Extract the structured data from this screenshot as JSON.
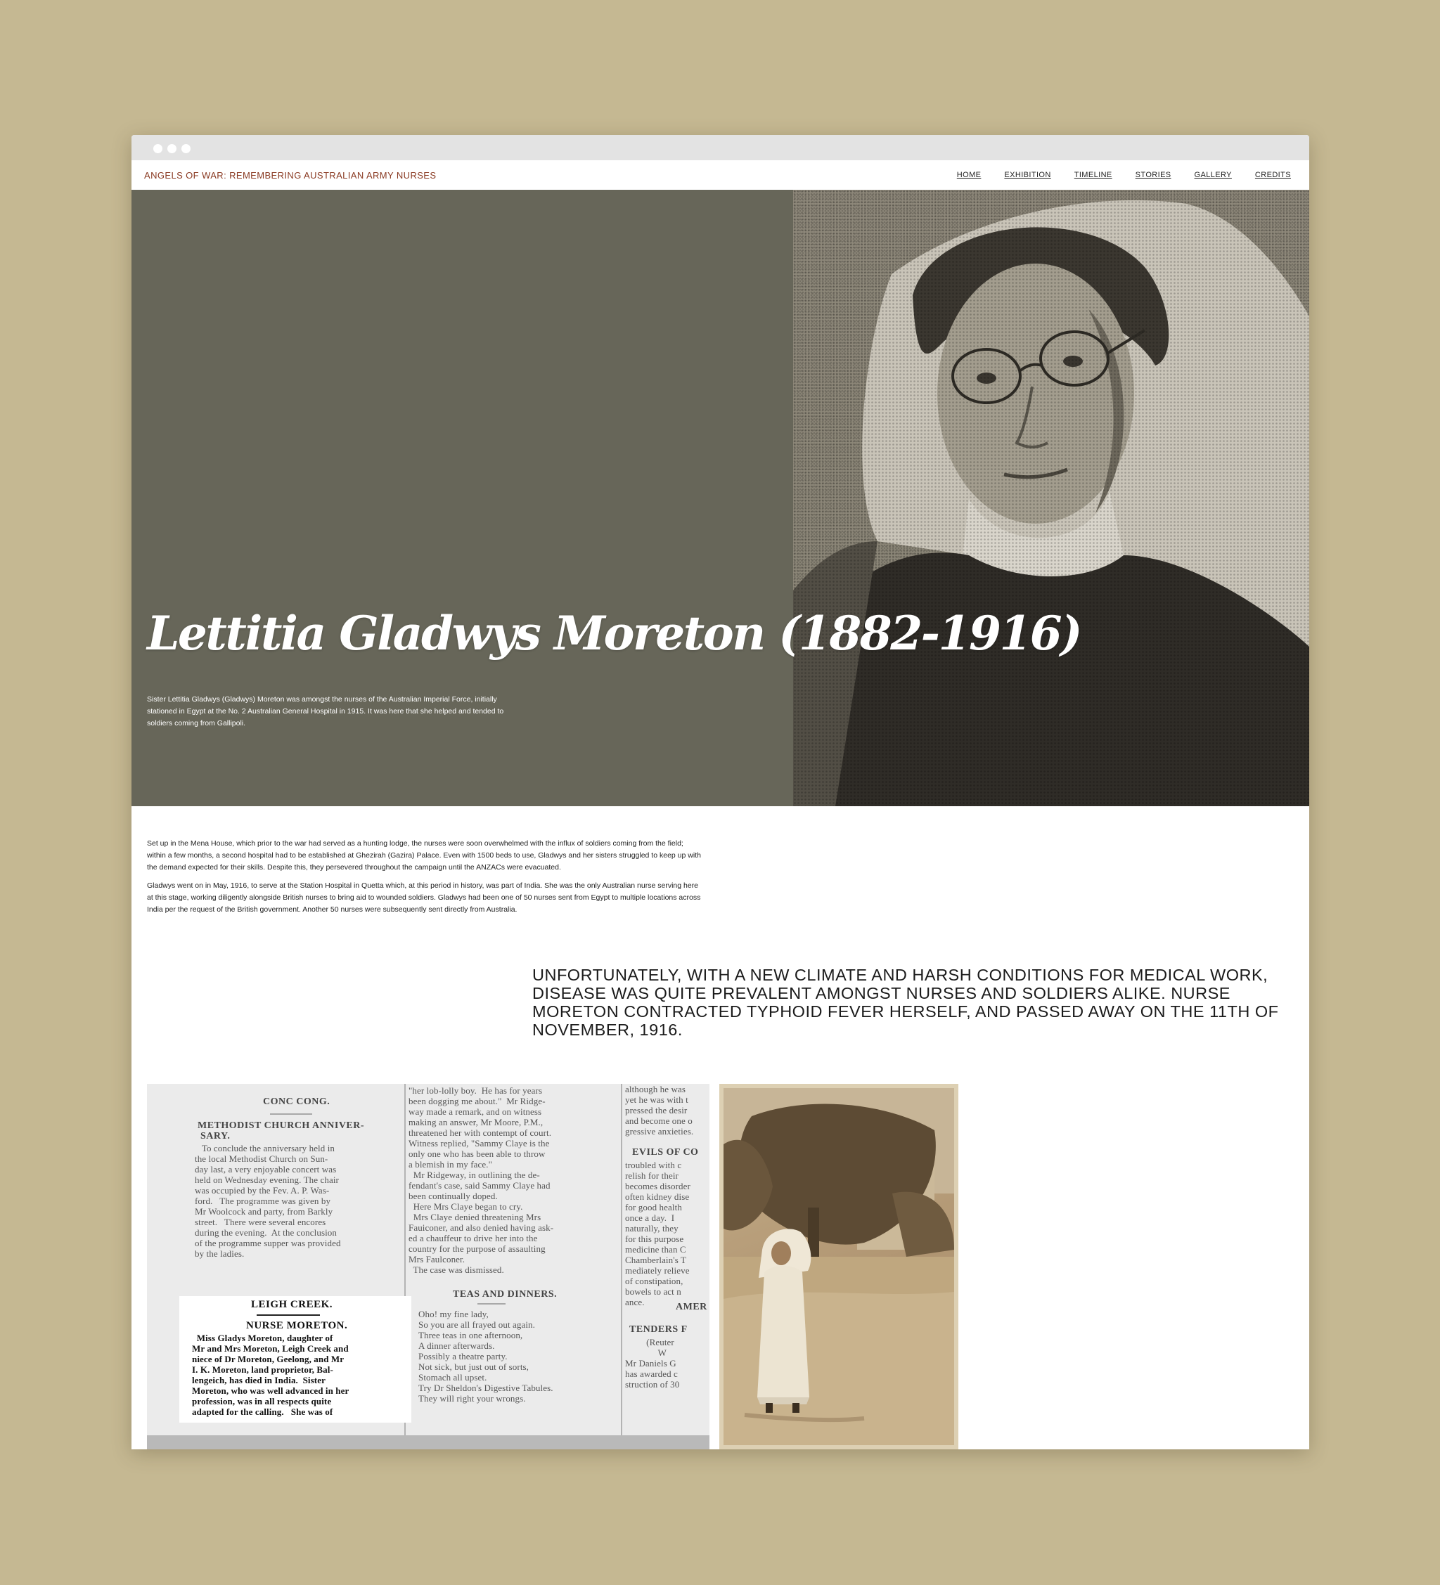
{
  "nav": {
    "site_title": "ANGELS OF WAR: REMEMBERING AUSTRALIAN ARMY NURSES",
    "items": [
      "HOME",
      "EXHIBITION",
      "TIMELINE",
      "STORIES",
      "GALLERY",
      "CREDITS"
    ]
  },
  "hero": {
    "title": "Lettitia Gladwys Moreton (1882-1916)",
    "intro": "Sister Lettitia Gladwys (Gladwys) Moreton was amongst the nurses of the Australian Imperial Force, initially stationed in Egypt at the No. 2 Australian General Hospital in 1915. It was here that she helped and tended to soldiers coming from Gallipoli."
  },
  "body": {
    "p1": "Set up in the Mena House, which prior to the war had served as a hunting lodge, the nurses were soon overwhelmed with the influx of soldiers coming from the field; within a few months, a second hospital had to be established at Ghezirah (Gazira) Palace. Even with 1500 beds to use, Gladwys and her sisters struggled to keep up with the demand expected for their skills. Despite this, they persevered throughout the campaign until the ANZACs were evacuated.",
    "p2": "Gladwys went on in May, 1916, to serve at the Station Hospital in Quetta which, at this period in history, was part of India. She was the only Australian nurse serving here at this stage, working diligently alongside British nurses to bring aid to wounded soldiers. Gladwys had been one of 50 nurses sent from Egypt to multiple locations across India per the request of the British government. Another 50 nurses were subsequently sent directly from Australia."
  },
  "pullquote": "Unfortunately, with a new climate and harsh conditions for medical work, disease was quite prevalent amongst nurses and soldiers alike. Nurse Moreton contracted typhoid fever herself, and passed away on the 11th of November, 1916.",
  "clipping": {
    "col1_head1": "CONC CONG.",
    "col1_head2": "METHODIST CHURCH ANNIVER-\n SARY.",
    "col1_text": "   To conclude the anniversary held in\nthe local Methodist Church on Sun-\nday last, a very enjoyable concert was\nheld on Wednesday evening. The chair\nwas occupied by the Fev. A. P. Was-\nford.   The programme was given by\nMr Woolcock and party, from Barkly\nstreet.   There were several encores\nduring the evening.  At the conclusion\nof the programme supper was provided\nby the ladies.",
    "notice_head1": "LEIGH CREEK.",
    "notice_head2": "NURSE MORETON.",
    "notice_text": "  Miss Gladys Moreton, daughter of\nMr and Mrs Moreton, Leigh Creek and\nniece of Dr Moreton, Geelong, and Mr\nI. K. Moreton, land proprietor, Bal-\nlengeich, has died in India.  Sister\nMoreton, who was well advanced in her\nprofession, was in all respects quite\nadapted for the calling.   She was of",
    "col2_text": "\"her lob-lolly boy.  He has for years\nbeen dogging me about.\"  Mr Ridge-\nway made a remark, and on witness\nmaking an answer, Mr Moore, P.M.,\nthreatened her with contempt of court.\nWitness replied, \"Sammy Claye is the\nonly one who has been able to throw\na blemish in my face.\"\n  Mr Ridgeway, in outlining the de-\nfendant's case, said Sammy Claye had\nbeen continually doped.\n  Here Mrs Claye began to cry.\n  Mrs Claye denied threatening Mrs\nFauiconer, and also denied having ask-\ned a chauffeur to drive her into the\ncountry for the purpose of assaulting\nMrs Faulconer.\n  The case was dismissed.",
    "col2_head": "TEAS AND DINNERS.",
    "col2_poem": "Oho! my fine lady,\nSo you are all frayed out again.\nThree teas in one afternoon,\nA dinner afterwards.\nPossibly a theatre party.\nNot sick, but just out of sorts,\nStomach all upset.\nTry Dr Sheldon's Digestive Tabules.\nThey will right your wrongs.",
    "col3_text": "although he was\nyet he was with t\npressed the desir\nand become one o\ngressive anxieties.",
    "col3_head": "EVILS OF CO",
    "col3_text2": "troubled with c\nrelish for their\nbecomes disorder\noften kidney dise\nfor good health\nonce a day.  I\nnaturally, they\nfor this purpose\nmedicine than C\nChamberlain's T\nmediately relieve\nof constipation,\nbowels to act n\nance.",
    "col3_head2": "AMER",
    "col3_head3": "TENDERS F",
    "col3_text3": "         (Reuter\n              W\nMr Daniels G\nhas awarded c\nstruction of 30"
  }
}
